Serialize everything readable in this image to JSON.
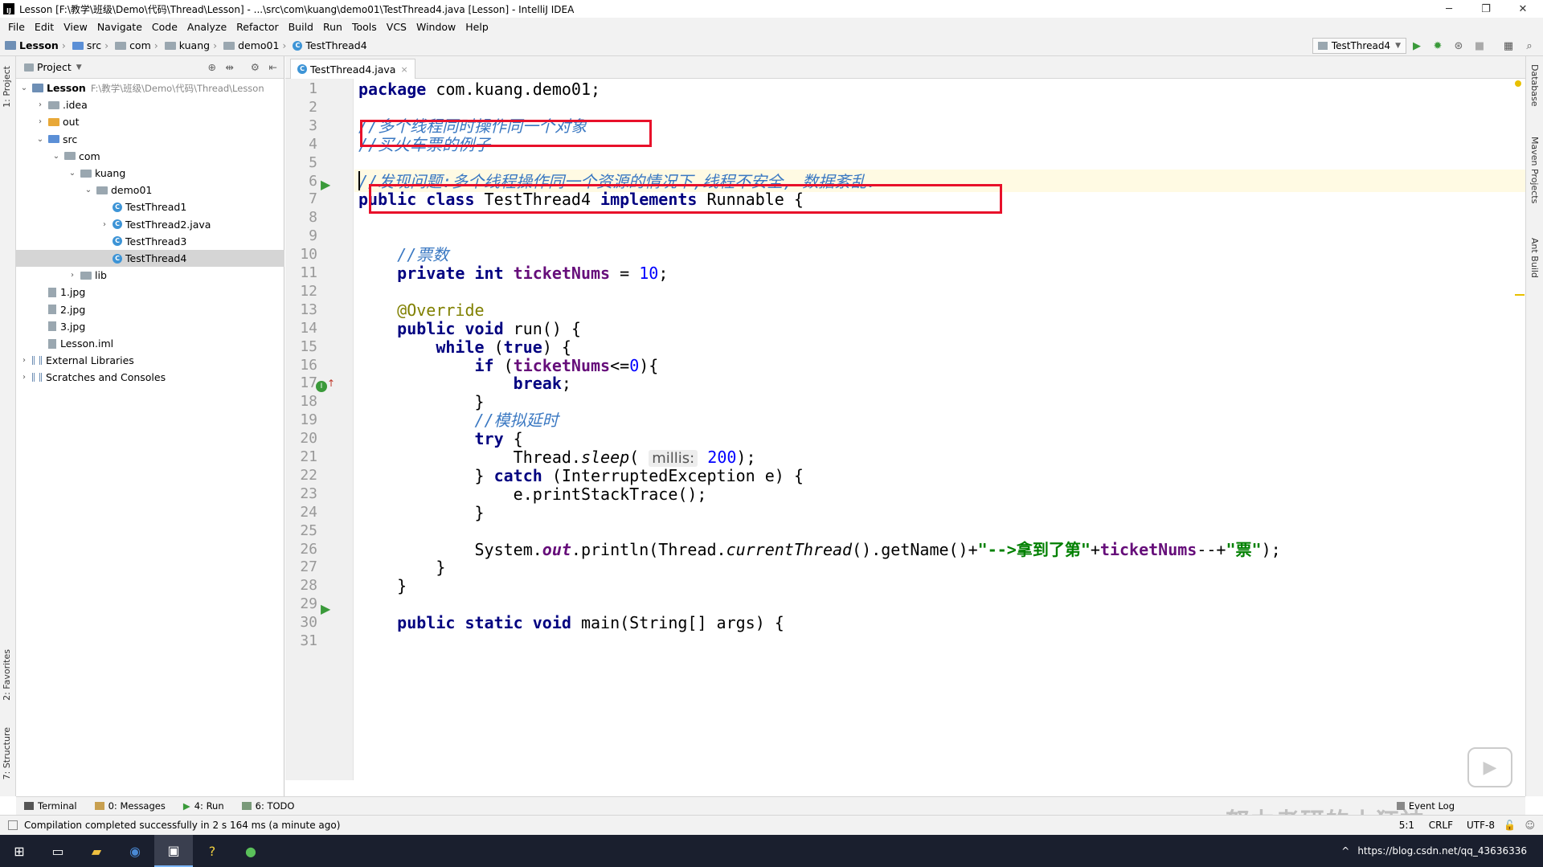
{
  "window": {
    "title": "Lesson [F:\\教学\\班级\\Demo\\代码\\Thread\\Lesson] - ...\\src\\com\\kuang\\demo01\\TestThread4.java [Lesson] - IntelliJ IDEA",
    "minimize": "─",
    "restore": "❐",
    "close": "✕"
  },
  "menu": [
    "File",
    "Edit",
    "View",
    "Navigate",
    "Code",
    "Analyze",
    "Refactor",
    "Build",
    "Run",
    "Tools",
    "VCS",
    "Window",
    "Help"
  ],
  "breadcrumb": [
    "Lesson",
    "src",
    "com",
    "kuang",
    "demo01",
    "TestThread4"
  ],
  "toolbar": {
    "run_config": "TestThread4",
    "run_icon": "run-icon",
    "debug_icon": "debug-icon",
    "search_icon": "search-icon"
  },
  "side_tabs": {
    "left": [
      "1: Project",
      "2: Favorites",
      "7: Structure"
    ],
    "right": [
      "Database",
      "Maven Projects",
      "Ant Build"
    ]
  },
  "project": {
    "header": "Project",
    "tree": [
      {
        "label": "Lesson",
        "hint": "F:\\教学\\班级\\Demo\\代码\\Thread\\Lesson",
        "depth": 0,
        "arrow": "open",
        "icon": "module",
        "bold": true
      },
      {
        "label": ".idea",
        "depth": 1,
        "arrow": "closed",
        "icon": "folder"
      },
      {
        "label": "out",
        "depth": 1,
        "arrow": "closed",
        "icon": "folder-orange"
      },
      {
        "label": "src",
        "depth": 1,
        "arrow": "open",
        "icon": "folder-blue"
      },
      {
        "label": "com",
        "depth": 2,
        "arrow": "open",
        "icon": "folder"
      },
      {
        "label": "kuang",
        "depth": 3,
        "arrow": "open",
        "icon": "folder"
      },
      {
        "label": "demo01",
        "depth": 4,
        "arrow": "open",
        "icon": "folder"
      },
      {
        "label": "TestThread1",
        "depth": 5,
        "arrow": "none",
        "icon": "class"
      },
      {
        "label": "TestThread2.java",
        "depth": 5,
        "arrow": "closed",
        "icon": "class"
      },
      {
        "label": "TestThread3",
        "depth": 5,
        "arrow": "none",
        "icon": "class"
      },
      {
        "label": "TestThread4",
        "depth": 5,
        "arrow": "none",
        "icon": "class",
        "selected": true
      },
      {
        "label": "lib",
        "depth": 3,
        "arrow": "closed",
        "icon": "folder"
      },
      {
        "label": "1.jpg",
        "depth": 1,
        "arrow": "none",
        "icon": "file"
      },
      {
        "label": "2.jpg",
        "depth": 1,
        "arrow": "none",
        "icon": "file"
      },
      {
        "label": "3.jpg",
        "depth": 1,
        "arrow": "none",
        "icon": "file"
      },
      {
        "label": "Lesson.iml",
        "depth": 1,
        "arrow": "none",
        "icon": "file"
      },
      {
        "label": "External Libraries",
        "depth": 0,
        "arrow": "closed",
        "icon": "lib"
      },
      {
        "label": "Scratches and Consoles",
        "depth": 0,
        "arrow": "closed",
        "icon": "lib"
      }
    ]
  },
  "editor": {
    "tab": "TestThread4.java",
    "caret_line": 5,
    "lines": [
      {
        "n": "1",
        "html": "<span class=\"kw\">package</span> com.kuang.demo01;"
      },
      {
        "n": "2",
        "html": ""
      },
      {
        "n": "3",
        "html": "<span class=\"cmt\">//多个线程同时操作同一个对象</span>"
      },
      {
        "n": "4",
        "html": "<span class=\"cmt\">//买火车票的例子</span>"
      },
      {
        "n": "5",
        "html": ""
      },
      {
        "n": "6",
        "html": "<span class=\"cmt\">//发现问题:多个线程操作同一个资源的情况下,线程不安全, 数据紊乱.</span>"
      },
      {
        "n": "7",
        "html": "<span class=\"kw\">public class</span> TestThread4 <span class=\"kw\">implements</span> Runnable {"
      },
      {
        "n": "8",
        "html": ""
      },
      {
        "n": "9",
        "html": ""
      },
      {
        "n": "10",
        "html": "    <span class=\"cmt\">//票数</span>"
      },
      {
        "n": "11",
        "html": "    <span class=\"kw\">private int</span> <span class=\"field\">ticketNums</span> = <span class=\"num\">10</span>;"
      },
      {
        "n": "12",
        "html": ""
      },
      {
        "n": "13",
        "html": "    <span class=\"anno\">@Override</span>"
      },
      {
        "n": "14",
        "html": "    <span class=\"kw\">public void</span> run() {"
      },
      {
        "n": "15",
        "html": "        <span class=\"kw\">while</span> (<span class=\"kw\">true</span>) {"
      },
      {
        "n": "16",
        "html": "            <span class=\"kw\">if</span> (<span class=\"field\">ticketNums</span>&lt;=<span class=\"num\">0</span>){"
      },
      {
        "n": "17",
        "html": "                <span class=\"kw\">break</span>;"
      },
      {
        "n": "18",
        "html": "            }"
      },
      {
        "n": "19",
        "html": "            <span class=\"cmt\">//模拟延时</span>"
      },
      {
        "n": "20",
        "html": "            <span class=\"kw\">try</span> {"
      },
      {
        "n": "21",
        "html": "                Thread.<span class=\"italic\">sleep</span>( <span class=\"hint\">millis:</span> <span class=\"num\">200</span>);"
      },
      {
        "n": "22",
        "html": "            } <span class=\"kw\">catch</span> (InterruptedException e) {"
      },
      {
        "n": "23",
        "html": "                e.printStackTrace();"
      },
      {
        "n": "24",
        "html": "            }"
      },
      {
        "n": "25",
        "html": ""
      },
      {
        "n": "26",
        "html": "            System.<span class=\"static-field\">out</span>.println(Thread.<span class=\"italic\">currentThread</span>().getName()+<span class=\"str\">\"--&gt;拿到了第\"</span>+<span class=\"field\">ticketNums</span>--+<span class=\"str\">\"票\"</span>);"
      },
      {
        "n": "27",
        "html": "        }"
      },
      {
        "n": "28",
        "html": "    }"
      },
      {
        "n": "29",
        "html": ""
      },
      {
        "n": "30",
        "html": "    <span class=\"kw\">public static void</span> main(String[] args) {"
      },
      {
        "n": "31",
        "html": ""
      }
    ]
  },
  "bottom_tools": [
    "Terminal",
    "0: Messages",
    "4: Run",
    "6: TODO"
  ],
  "event_log": "Event Log",
  "status": {
    "message": "Compilation completed successfully in 2 s 164 ms (a minute ago)",
    "position": "5:1",
    "line_sep": "CRLF",
    "encoding": "UTF-8"
  },
  "watermark": "努力考研的小狂神",
  "taskbar": {
    "tray_text": "https://blog.csdn.net/qq_43636336"
  }
}
